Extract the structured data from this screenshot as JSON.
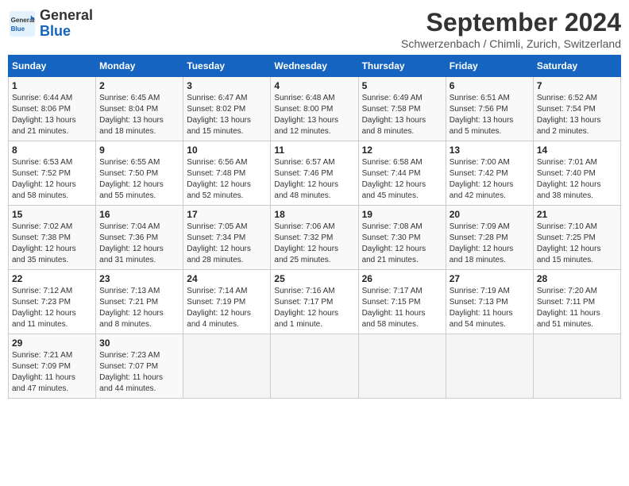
{
  "header": {
    "logo_line1": "General",
    "logo_line2": "Blue",
    "month_year": "September 2024",
    "location": "Schwerzenbach / Chimli, Zurich, Switzerland"
  },
  "days_of_week": [
    "Sunday",
    "Monday",
    "Tuesday",
    "Wednesday",
    "Thursday",
    "Friday",
    "Saturday"
  ],
  "weeks": [
    [
      {
        "day": "1",
        "info": "Sunrise: 6:44 AM\nSunset: 8:06 PM\nDaylight: 13 hours\nand 21 minutes."
      },
      {
        "day": "2",
        "info": "Sunrise: 6:45 AM\nSunset: 8:04 PM\nDaylight: 13 hours\nand 18 minutes."
      },
      {
        "day": "3",
        "info": "Sunrise: 6:47 AM\nSunset: 8:02 PM\nDaylight: 13 hours\nand 15 minutes."
      },
      {
        "day": "4",
        "info": "Sunrise: 6:48 AM\nSunset: 8:00 PM\nDaylight: 13 hours\nand 12 minutes."
      },
      {
        "day": "5",
        "info": "Sunrise: 6:49 AM\nSunset: 7:58 PM\nDaylight: 13 hours\nand 8 minutes."
      },
      {
        "day": "6",
        "info": "Sunrise: 6:51 AM\nSunset: 7:56 PM\nDaylight: 13 hours\nand 5 minutes."
      },
      {
        "day": "7",
        "info": "Sunrise: 6:52 AM\nSunset: 7:54 PM\nDaylight: 13 hours\nand 2 minutes."
      }
    ],
    [
      {
        "day": "8",
        "info": "Sunrise: 6:53 AM\nSunset: 7:52 PM\nDaylight: 12 hours\nand 58 minutes."
      },
      {
        "day": "9",
        "info": "Sunrise: 6:55 AM\nSunset: 7:50 PM\nDaylight: 12 hours\nand 55 minutes."
      },
      {
        "day": "10",
        "info": "Sunrise: 6:56 AM\nSunset: 7:48 PM\nDaylight: 12 hours\nand 52 minutes."
      },
      {
        "day": "11",
        "info": "Sunrise: 6:57 AM\nSunset: 7:46 PM\nDaylight: 12 hours\nand 48 minutes."
      },
      {
        "day": "12",
        "info": "Sunrise: 6:58 AM\nSunset: 7:44 PM\nDaylight: 12 hours\nand 45 minutes."
      },
      {
        "day": "13",
        "info": "Sunrise: 7:00 AM\nSunset: 7:42 PM\nDaylight: 12 hours\nand 42 minutes."
      },
      {
        "day": "14",
        "info": "Sunrise: 7:01 AM\nSunset: 7:40 PM\nDaylight: 12 hours\nand 38 minutes."
      }
    ],
    [
      {
        "day": "15",
        "info": "Sunrise: 7:02 AM\nSunset: 7:38 PM\nDaylight: 12 hours\nand 35 minutes."
      },
      {
        "day": "16",
        "info": "Sunrise: 7:04 AM\nSunset: 7:36 PM\nDaylight: 12 hours\nand 31 minutes."
      },
      {
        "day": "17",
        "info": "Sunrise: 7:05 AM\nSunset: 7:34 PM\nDaylight: 12 hours\nand 28 minutes."
      },
      {
        "day": "18",
        "info": "Sunrise: 7:06 AM\nSunset: 7:32 PM\nDaylight: 12 hours\nand 25 minutes."
      },
      {
        "day": "19",
        "info": "Sunrise: 7:08 AM\nSunset: 7:30 PM\nDaylight: 12 hours\nand 21 minutes."
      },
      {
        "day": "20",
        "info": "Sunrise: 7:09 AM\nSunset: 7:28 PM\nDaylight: 12 hours\nand 18 minutes."
      },
      {
        "day": "21",
        "info": "Sunrise: 7:10 AM\nSunset: 7:25 PM\nDaylight: 12 hours\nand 15 minutes."
      }
    ],
    [
      {
        "day": "22",
        "info": "Sunrise: 7:12 AM\nSunset: 7:23 PM\nDaylight: 12 hours\nand 11 minutes."
      },
      {
        "day": "23",
        "info": "Sunrise: 7:13 AM\nSunset: 7:21 PM\nDaylight: 12 hours\nand 8 minutes."
      },
      {
        "day": "24",
        "info": "Sunrise: 7:14 AM\nSunset: 7:19 PM\nDaylight: 12 hours\nand 4 minutes."
      },
      {
        "day": "25",
        "info": "Sunrise: 7:16 AM\nSunset: 7:17 PM\nDaylight: 12 hours\nand 1 minute."
      },
      {
        "day": "26",
        "info": "Sunrise: 7:17 AM\nSunset: 7:15 PM\nDaylight: 11 hours\nand 58 minutes."
      },
      {
        "day": "27",
        "info": "Sunrise: 7:19 AM\nSunset: 7:13 PM\nDaylight: 11 hours\nand 54 minutes."
      },
      {
        "day": "28",
        "info": "Sunrise: 7:20 AM\nSunset: 7:11 PM\nDaylight: 11 hours\nand 51 minutes."
      }
    ],
    [
      {
        "day": "29",
        "info": "Sunrise: 7:21 AM\nSunset: 7:09 PM\nDaylight: 11 hours\nand 47 minutes."
      },
      {
        "day": "30",
        "info": "Sunrise: 7:23 AM\nSunset: 7:07 PM\nDaylight: 11 hours\nand 44 minutes."
      },
      {
        "day": "",
        "info": ""
      },
      {
        "day": "",
        "info": ""
      },
      {
        "day": "",
        "info": ""
      },
      {
        "day": "",
        "info": ""
      },
      {
        "day": "",
        "info": ""
      }
    ]
  ]
}
